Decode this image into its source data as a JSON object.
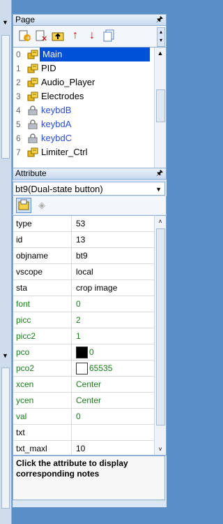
{
  "page_panel": {
    "title": "Page",
    "pin": "⮟",
    "pages": [
      {
        "num": "0",
        "label": "Main",
        "icon": "page-icon",
        "locked": false
      },
      {
        "num": "1",
        "label": "PID",
        "icon": "page-icon",
        "locked": false
      },
      {
        "num": "2",
        "label": "Audio_Player",
        "icon": "page-icon",
        "locked": false
      },
      {
        "num": "3",
        "label": "Electrodes",
        "icon": "page-icon",
        "locked": false
      },
      {
        "num": "4",
        "label": "keybdB",
        "icon": "lock-icon",
        "locked": true
      },
      {
        "num": "5",
        "label": "keybdA",
        "icon": "lock-icon",
        "locked": true
      },
      {
        "num": "6",
        "label": "keybdC",
        "icon": "lock-icon",
        "locked": true
      },
      {
        "num": "7",
        "label": "Limiter_Ctrl",
        "icon": "page-icon",
        "locked": false
      }
    ]
  },
  "attr_panel": {
    "title": "Attribute",
    "selected_component": "bt9(Dual-state button)",
    "rows": [
      {
        "key": "type",
        "value": "53",
        "green": false
      },
      {
        "key": "id",
        "value": "13",
        "green": false
      },
      {
        "key": "objname",
        "value": "bt9",
        "green": false
      },
      {
        "key": "vscope",
        "value": "local",
        "green": false
      },
      {
        "key": "sta",
        "value": "crop image",
        "green": false
      },
      {
        "key": "font",
        "value": "0",
        "green": true
      },
      {
        "key": "picc",
        "value": "2",
        "green": true
      },
      {
        "key": "picc2",
        "value": "1",
        "green": true
      },
      {
        "key": "pco",
        "value": "0",
        "green": true,
        "swatch": "#000000"
      },
      {
        "key": "pco2",
        "value": "65535",
        "green": true,
        "swatch": "#ffffff"
      },
      {
        "key": "xcen",
        "value": "Center",
        "green": true
      },
      {
        "key": "ycen",
        "value": "Center",
        "green": true
      },
      {
        "key": "val",
        "value": "0",
        "green": true
      },
      {
        "key": "txt",
        "value": "",
        "green": false
      },
      {
        "key": "txt_maxl",
        "value": "10",
        "green": false
      }
    ],
    "notes": "Click the attribute to display corresponding notes"
  },
  "colors": {
    "selection": "#0050d8",
    "locked_text": "#2a4ed8",
    "green_attr": "#1b7e1b",
    "background": "#5a8ec6"
  }
}
